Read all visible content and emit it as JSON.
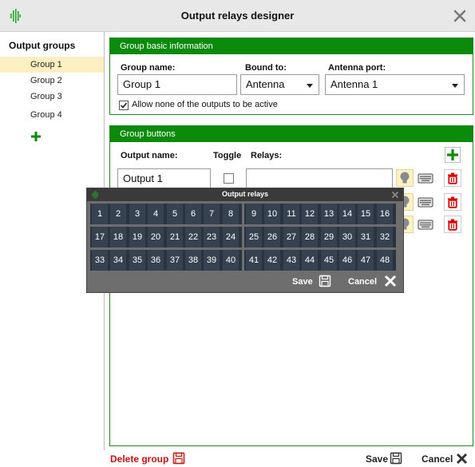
{
  "window": {
    "title": "Output relays designer"
  },
  "sidebar": {
    "title": "Output groups",
    "groups": [
      "Group 1",
      "Group 2",
      "Group 3",
      "Group 4"
    ]
  },
  "basic": {
    "header": "Group basic information",
    "group_name_label": "Group name:",
    "group_name_value": "Group 1",
    "bound_to_label": "Bound to:",
    "bound_to_value": "Antenna",
    "antenna_port_label": "Antenna port:",
    "antenna_port_value": "Antenna 1",
    "allow_none_label": "Allow none of the outputs to be active",
    "allow_none_checked": true
  },
  "buttons_panel": {
    "header": "Group buttons",
    "output_name_label": "Output name:",
    "toggle_label": "Toggle",
    "relays_label": "Relays:",
    "rows": [
      {
        "output_name": "Output 1"
      }
    ]
  },
  "popup": {
    "title": "Output relays",
    "relays": [
      "1",
      "2",
      "3",
      "4",
      "5",
      "6",
      "7",
      "8",
      "9",
      "10",
      "11",
      "12",
      "13",
      "14",
      "15",
      "16",
      "17",
      "18",
      "19",
      "20",
      "21",
      "22",
      "23",
      "24",
      "25",
      "26",
      "27",
      "28",
      "29",
      "30",
      "31",
      "32",
      "33",
      "34",
      "35",
      "36",
      "37",
      "38",
      "39",
      "40",
      "41",
      "42",
      "43",
      "44",
      "45",
      "46",
      "47",
      "48"
    ],
    "save_label": "Save",
    "cancel_label": "Cancel"
  },
  "footer": {
    "delete_label": "Delete group",
    "save_label": "Save",
    "cancel_label": "Cancel"
  },
  "colors": {
    "accent_green": "#0c8a0c",
    "selected_row": "#fcefc2",
    "delete_red": "#cc1111",
    "popup_bg": "#6e6e6e",
    "relay_tile": "#374250"
  },
  "icons": {
    "app": "sound-wave-icon",
    "close": "close-x-icon",
    "add": "plus-icon",
    "save": "floppy-disk-icon",
    "delete": "trash-icon",
    "bulb": "lightbulb-icon",
    "keyboard": "keyboard-icon"
  }
}
